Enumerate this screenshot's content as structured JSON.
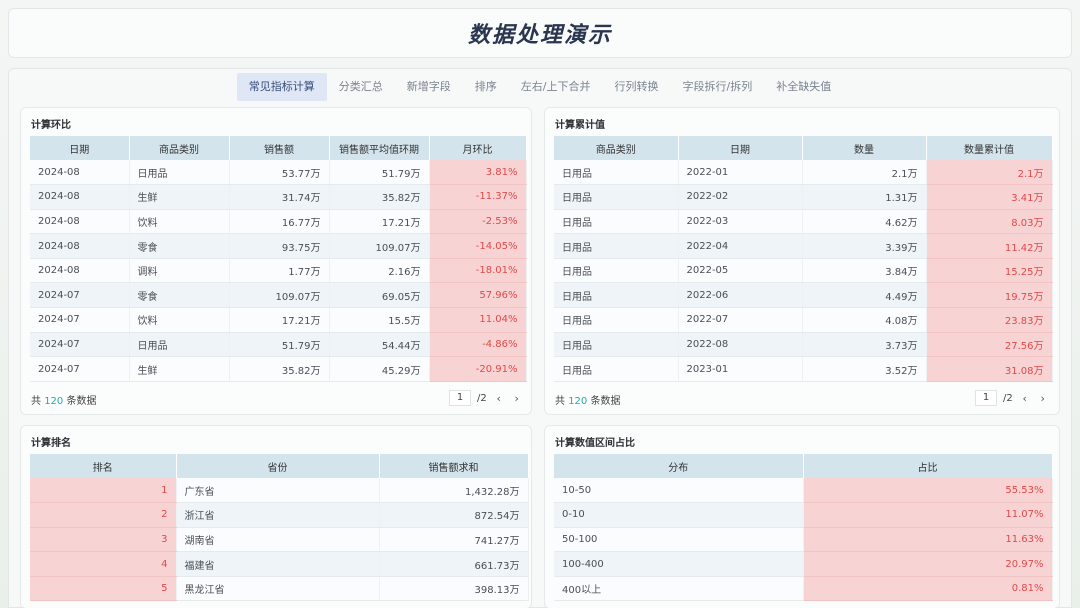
{
  "title": "数据处理演示",
  "tabs": [
    "常见指标计算",
    "分类汇总",
    "新增字段",
    "排序",
    "左右/上下合并",
    "行列转换",
    "字段拆行/拆列",
    "补全缺失值"
  ],
  "panels": {
    "hb": {
      "title": "计算环比",
      "headers": [
        "日期",
        "商品类别",
        "销售额",
        "销售额平均值环期",
        "月环比"
      ],
      "rows": [
        [
          "2024-08",
          "日用品",
          "53.77万",
          "51.79万",
          "3.81%"
        ],
        [
          "2024-08",
          "生鲜",
          "31.74万",
          "35.82万",
          "-11.37%"
        ],
        [
          "2024-08",
          "饮料",
          "16.77万",
          "17.21万",
          "-2.53%"
        ],
        [
          "2024-08",
          "零食",
          "93.75万",
          "109.07万",
          "-14.05%"
        ],
        [
          "2024-08",
          "调料",
          "1.77万",
          "2.16万",
          "-18.01%"
        ],
        [
          "2024-07",
          "零食",
          "109.07万",
          "69.05万",
          "57.96%"
        ],
        [
          "2024-07",
          "饮料",
          "17.21万",
          "15.5万",
          "11.04%"
        ],
        [
          "2024-07",
          "日用品",
          "51.79万",
          "54.44万",
          "-4.86%"
        ],
        [
          "2024-07",
          "生鲜",
          "35.82万",
          "45.29万",
          "-20.91%"
        ]
      ],
      "footer_prefix": "共",
      "footer_count": "120",
      "footer_suffix": "条数据",
      "page": "1",
      "pages": "/2"
    },
    "lj": {
      "title": "计算累计值",
      "headers": [
        "商品类别",
        "日期",
        "数量",
        "数量累计值"
      ],
      "rows": [
        [
          "日用品",
          "2022-01",
          "2.1万",
          "2.1万"
        ],
        [
          "日用品",
          "2022-02",
          "1.31万",
          "3.41万"
        ],
        [
          "日用品",
          "2022-03",
          "4.62万",
          "8.03万"
        ],
        [
          "日用品",
          "2022-04",
          "3.39万",
          "11.42万"
        ],
        [
          "日用品",
          "2022-05",
          "3.84万",
          "15.25万"
        ],
        [
          "日用品",
          "2022-06",
          "4.49万",
          "19.75万"
        ],
        [
          "日用品",
          "2022-07",
          "4.08万",
          "23.83万"
        ],
        [
          "日用品",
          "2022-08",
          "3.73万",
          "27.56万"
        ],
        [
          "日用品",
          "2023-01",
          "3.52万",
          "31.08万"
        ]
      ],
      "footer_prefix": "共",
      "footer_count": "120",
      "footer_suffix": "条数据",
      "page": "1",
      "pages": "/2"
    },
    "pm": {
      "title": "计算排名",
      "headers": [
        "排名",
        "省份",
        "销售额求和"
      ],
      "rows": [
        [
          "1",
          "广东省",
          "1,432.28万"
        ],
        [
          "2",
          "浙江省",
          "872.54万"
        ],
        [
          "3",
          "湖南省",
          "741.27万"
        ],
        [
          "4",
          "福建省",
          "661.73万"
        ],
        [
          "5",
          "黑龙江省",
          "398.13万"
        ]
      ]
    },
    "zb": {
      "title": "计算数值区间占比",
      "headers": [
        "分布",
        "占比"
      ],
      "rows": [
        [
          "10-50",
          "55.53%"
        ],
        [
          "0-10",
          "11.07%"
        ],
        [
          "50-100",
          "11.63%"
        ],
        [
          "100-400",
          "20.97%"
        ],
        [
          "400以上",
          "0.81%"
        ]
      ]
    }
  },
  "icons": {
    "prev": "chevron-left-icon",
    "next": "chevron-right-icon"
  },
  "colors": {
    "header_bg": "#d3e4ec",
    "highlight_bg": "#f7d3d3",
    "highlight_text": "#e04a4a",
    "count": "#2aa8a8"
  }
}
